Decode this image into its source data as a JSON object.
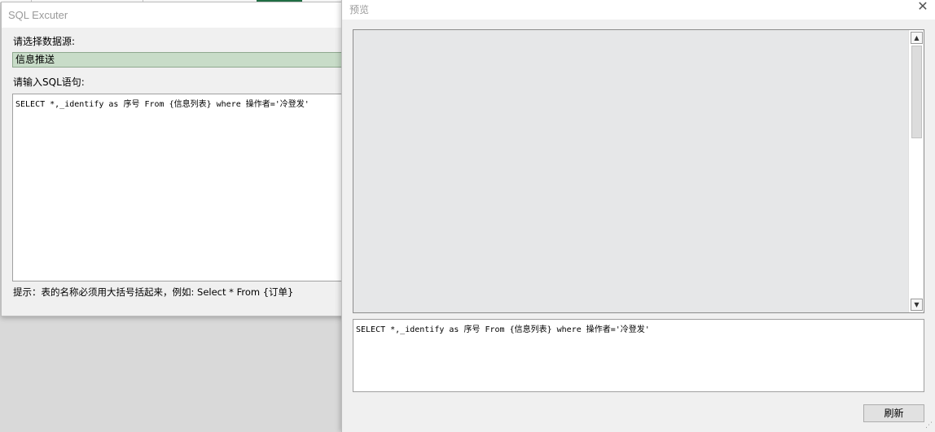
{
  "sql_dialog": {
    "title": "SQL Excuter",
    "source_label": "请选择数据源:",
    "source_value": "信息推送",
    "sql_label": "请输入SQL语句:",
    "sql_text": "SELECT *,_identify as 序号 From {信息列表} where 操作者='冷登发'",
    "hint": "提示：表的名称必须用大括号括起来，例如: Select * From {订单}"
  },
  "preview_dialog": {
    "title": "预览",
    "close_glyph": "✕",
    "sql_text": "SELECT *,_identify as 序号 From {信息列表} where 操作者='冷登发'",
    "refresh_label": "刷新",
    "scroll_up_glyph": "▲",
    "scroll_down_glyph": "▼",
    "resize_glyph": "⋰"
  }
}
